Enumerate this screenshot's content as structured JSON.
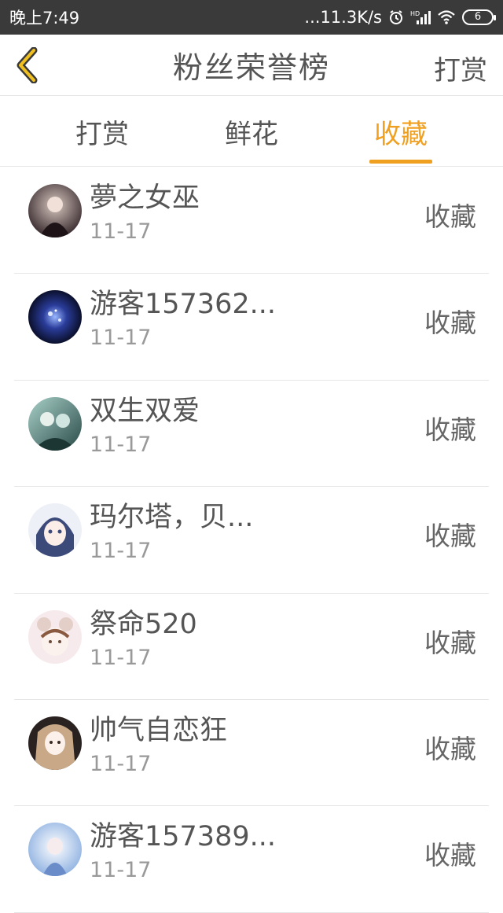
{
  "status_bar": {
    "time": "晚上7:49",
    "network_speed": "...11.3K/s",
    "icons": [
      "alarm-icon",
      "hd-signal-icon",
      "wifi-icon"
    ],
    "battery": "6"
  },
  "header": {
    "title": "粉丝荣誉榜",
    "action": "打赏",
    "back_icon": "chevron-left-icon"
  },
  "tabs": [
    {
      "label": "打赏"
    },
    {
      "label": "鲜花"
    },
    {
      "label": "收藏",
      "active": true
    }
  ],
  "colors": {
    "accent": "#f0a020",
    "status_bar": "#3a3a3a",
    "text": "#555555",
    "subtext": "#999999"
  },
  "fans": [
    {
      "name": "夢之女巫",
      "date": "11-17",
      "action": "收藏"
    },
    {
      "name": "游客157362...",
      "date": "11-17",
      "action": "收藏"
    },
    {
      "name": "双生双爱",
      "date": "11-17",
      "action": "收藏"
    },
    {
      "name": "玛尔塔，贝...",
      "date": "11-17",
      "action": "收藏"
    },
    {
      "name": "祭命520",
      "date": "11-17",
      "action": "收藏"
    },
    {
      "name": "帅气自恋狂",
      "date": "11-17",
      "action": "收藏"
    },
    {
      "name": "游客157389...",
      "date": "11-17",
      "action": "收藏"
    }
  ]
}
